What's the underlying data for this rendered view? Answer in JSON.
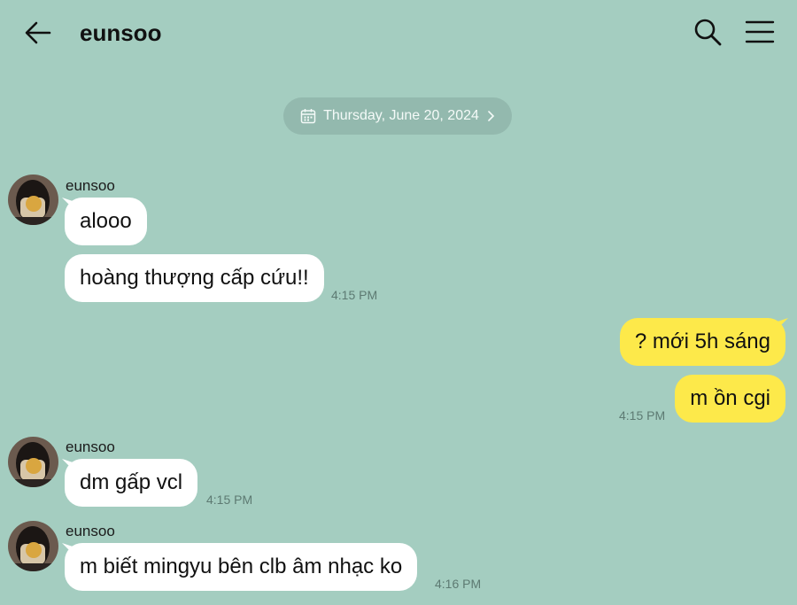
{
  "header": {
    "title": "eunsoo"
  },
  "date_pill": {
    "label": "Thursday, June 20, 2024"
  },
  "colors": {
    "background": "#a4cdc0",
    "outgoing_bubble": "#fde94a",
    "incoming_bubble": "#ffffff",
    "date_pill": "#93b9ae"
  },
  "messages": [
    {
      "sender": "eunsoo",
      "text": "alooo"
    },
    {
      "text": "hoàng thượng cấp cứu!!",
      "time": "4:15 PM"
    },
    {
      "text": "? mới 5h sáng"
    },
    {
      "text": "m ồn cgi",
      "time": "4:15 PM"
    },
    {
      "sender": "eunsoo",
      "text": "dm gấp vcl",
      "time": "4:15 PM"
    },
    {
      "sender": "eunsoo",
      "text": "m biết mingyu bên clb âm nhạc ko",
      "time": "4:16 PM"
    }
  ]
}
